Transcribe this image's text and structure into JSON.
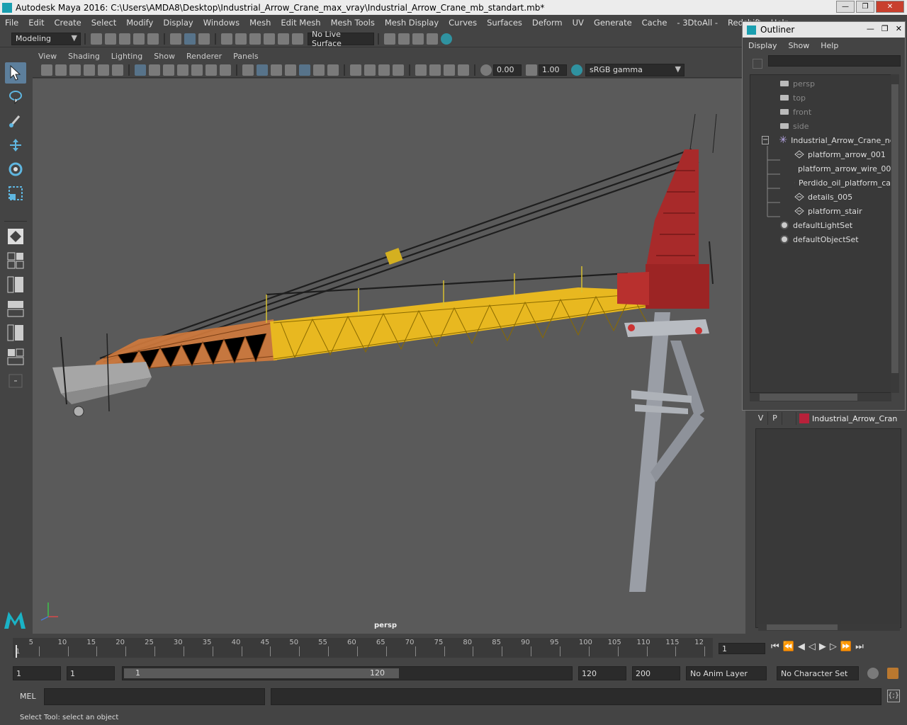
{
  "window": {
    "title": "Autodesk Maya 2016: C:\\Users\\AMDA8\\Desktop\\Industrial_Arrow_Crane_max_vray\\Industrial_Arrow_Crane_mb_standart.mb*",
    "min_glyph": "—",
    "max_glyph": "❐",
    "close_glyph": "✕"
  },
  "menubar": [
    "File",
    "Edit",
    "Create",
    "Select",
    "Modify",
    "Display",
    "Windows",
    "Mesh",
    "Edit Mesh",
    "Mesh Tools",
    "Mesh Display",
    "Curves",
    "Surfaces",
    "Deform",
    "UV",
    "Generate",
    "Cache",
    "- 3DtoAll -",
    "Redshift",
    "Help"
  ],
  "shelf": {
    "mode": "Modeling",
    "live_surface": "No Live Surface"
  },
  "panel_menu": [
    "View",
    "Shading",
    "Lighting",
    "Show",
    "Renderer",
    "Panels"
  ],
  "panel_tools": {
    "exposure": "0.00",
    "gamma": "1.00",
    "color_space": "sRGB gamma"
  },
  "viewport": {
    "camera_label": "persp",
    "colors": {
      "background": "#5a5a5a",
      "boom_orange": "#d27a3c",
      "boom_yellow": "#e8b820",
      "tower_red": "#a82a2a",
      "pillar": "#9a9ea6"
    }
  },
  "outliner": {
    "title": "Outliner",
    "menu": [
      "Display",
      "Show",
      "Help"
    ],
    "items": [
      {
        "label": "persp",
        "type": "camera",
        "dim": true
      },
      {
        "label": "top",
        "type": "camera",
        "dim": true
      },
      {
        "label": "front",
        "type": "camera",
        "dim": true
      },
      {
        "label": "side",
        "type": "camera",
        "dim": true
      },
      {
        "label": "Industrial_Arrow_Crane_ncl",
        "type": "group"
      },
      {
        "label": "platform_arrow_001",
        "type": "mesh"
      },
      {
        "label": "platform_arrow_wire_00",
        "type": "mesh"
      },
      {
        "label": "Perdido_oil_platform_ca",
        "type": "mesh"
      },
      {
        "label": "details_005",
        "type": "mesh"
      },
      {
        "label": "platform_stair",
        "type": "mesh"
      },
      {
        "label": "defaultLightSet",
        "type": "set"
      },
      {
        "label": "defaultObjectSet",
        "type": "set"
      }
    ]
  },
  "layers": {
    "v": "V",
    "p": "P",
    "color": "#b8213a",
    "name": "Industrial_Arrow_Cran"
  },
  "timeline": {
    "ticks": [
      "5",
      "10",
      "15",
      "20",
      "25",
      "30",
      "35",
      "40",
      "45",
      "50",
      "55",
      "60",
      "65",
      "70",
      "75",
      "80",
      "85",
      "90",
      "95",
      "100",
      "105",
      "110",
      "115",
      "12"
    ],
    "start": "1",
    "current_frame": "1"
  },
  "range": {
    "start": "1",
    "playback_start": "1",
    "slider_start": "1",
    "slider_end": "120",
    "playback_end": "120",
    "end": "200",
    "anim_layer": "No Anim Layer",
    "char_set": "No Character Set"
  },
  "cmd": {
    "label": "MEL"
  },
  "help_line": "Select Tool: select an object"
}
